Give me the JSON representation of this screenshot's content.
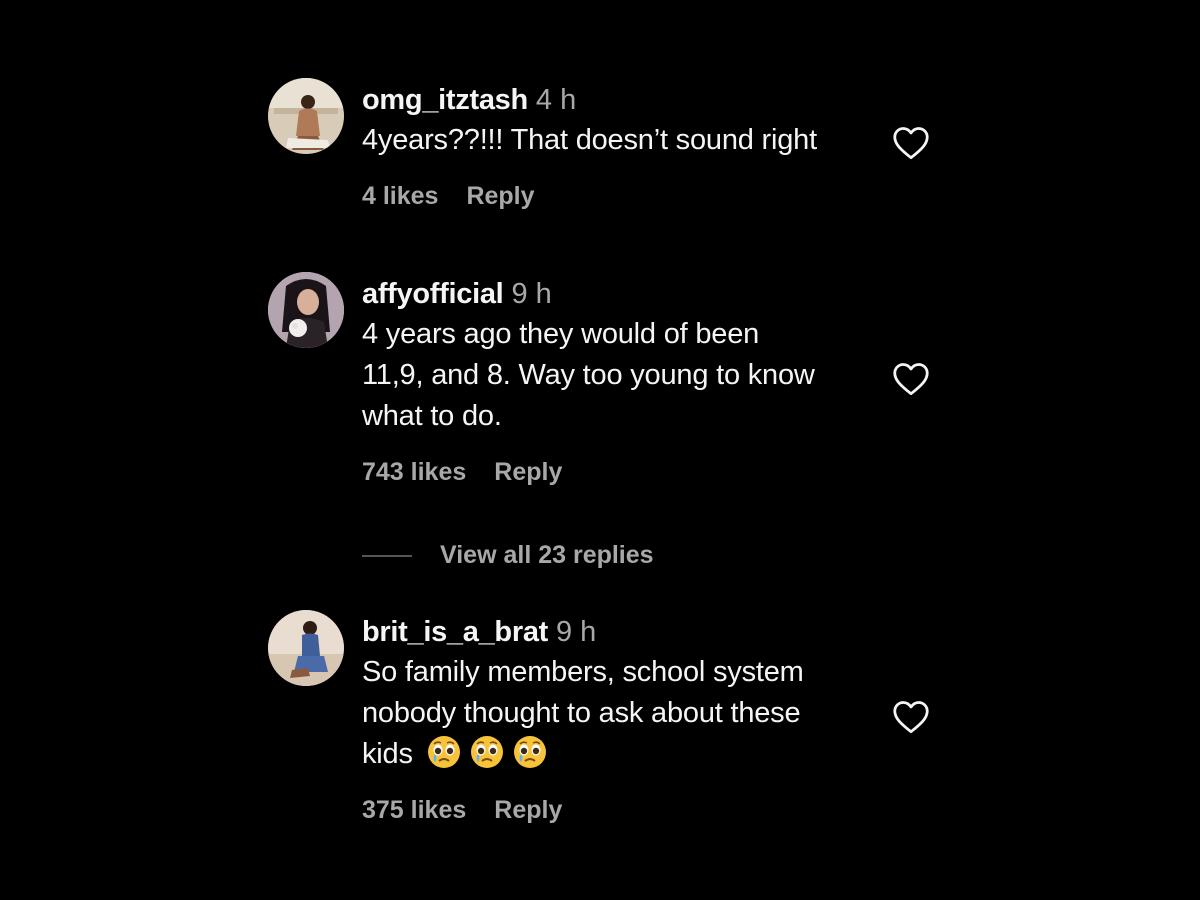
{
  "comments": [
    {
      "username": "omg_itztash",
      "time": "4 h",
      "text": "4years??!!! That doesn’t sound right",
      "likes": "4 likes",
      "reply": "Reply",
      "avatar_icon": "profile-photo"
    },
    {
      "username": "affyofficial",
      "time": "9 h",
      "text_lines": [
        "4 years ago they would of been",
        "11,9, and 8. Way too young to know",
        "what to do."
      ],
      "likes": "743 likes",
      "reply": "Reply",
      "avatar_icon": "profile-photo"
    },
    {
      "username": "brit_is_a_brat",
      "time": "9 h",
      "text_lines": [
        "So family members, school system",
        "nobody thought to ask about these",
        "kids"
      ],
      "emojis": [
        "pleading-crying-face-emoji",
        "pleading-crying-face-emoji",
        "pleading-crying-face-emoji"
      ],
      "likes": "375 likes",
      "reply": "Reply",
      "avatar_icon": "profile-photo"
    }
  ],
  "view_replies": {
    "label": "View all 23 replies"
  },
  "colors": {
    "background": "#000000",
    "primary_text": "#f5f5f5",
    "secondary_text": "#a8a8a8"
  }
}
